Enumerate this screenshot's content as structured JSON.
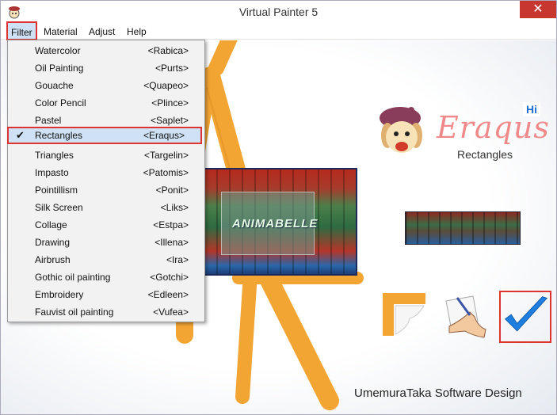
{
  "window": {
    "title": "Virtual Painter 5",
    "close_symbol": "✕"
  },
  "menubar": {
    "items": [
      "Filter",
      "Material",
      "Adjust",
      "Help"
    ]
  },
  "filter_menu": {
    "items": [
      {
        "label": "Watercolor",
        "shortcut": "<Rabica>"
      },
      {
        "label": "Oil Painting",
        "shortcut": "<Purts>"
      },
      {
        "label": "Gouache",
        "shortcut": "<Quapeo>"
      },
      {
        "label": "Color Pencil",
        "shortcut": "<Plince>"
      },
      {
        "label": "Pastel",
        "shortcut": "<Saplet>"
      },
      {
        "label": "Rectangles",
        "shortcut": "<Eraqus>",
        "checked": true
      },
      {
        "label": "Triangles",
        "shortcut": "<Targelin>"
      },
      {
        "label": "Impasto",
        "shortcut": "<Patomis>"
      },
      {
        "label": "Pointillism",
        "shortcut": "<Ponit>"
      },
      {
        "label": "Silk Screen",
        "shortcut": "<Liks>"
      },
      {
        "label": "Collage",
        "shortcut": "<Estpa>"
      },
      {
        "label": "Drawing",
        "shortcut": "<Illena>"
      },
      {
        "label": "Airbrush",
        "shortcut": "<Ira>"
      },
      {
        "label": "Gothic oil painting",
        "shortcut": "<Gotchi>"
      },
      {
        "label": "Embroidery",
        "shortcut": "<Edleen>"
      },
      {
        "label": "Fauvist oil painting",
        "shortcut": "<Vufea>"
      }
    ],
    "check_symbol": "✔"
  },
  "preview": {
    "watermark": "ANIMABELLE"
  },
  "brand": {
    "name": "Eraqus",
    "badge": "Hi",
    "current_filter": "Rectangles"
  },
  "tools": {
    "reset_icon": "frame-reset-icon",
    "draw_icon": "hand-pen-icon",
    "ok_icon": "checkmark-icon"
  },
  "footer": {
    "credit": "UmemuraTaka Software Design"
  },
  "colors": {
    "easel": "#f3a533",
    "highlight_border": "#dd3333",
    "menu_highlight": "#cfe1f5",
    "brand_text": "#f08a8a",
    "checkmark": "#1f7fe0"
  }
}
